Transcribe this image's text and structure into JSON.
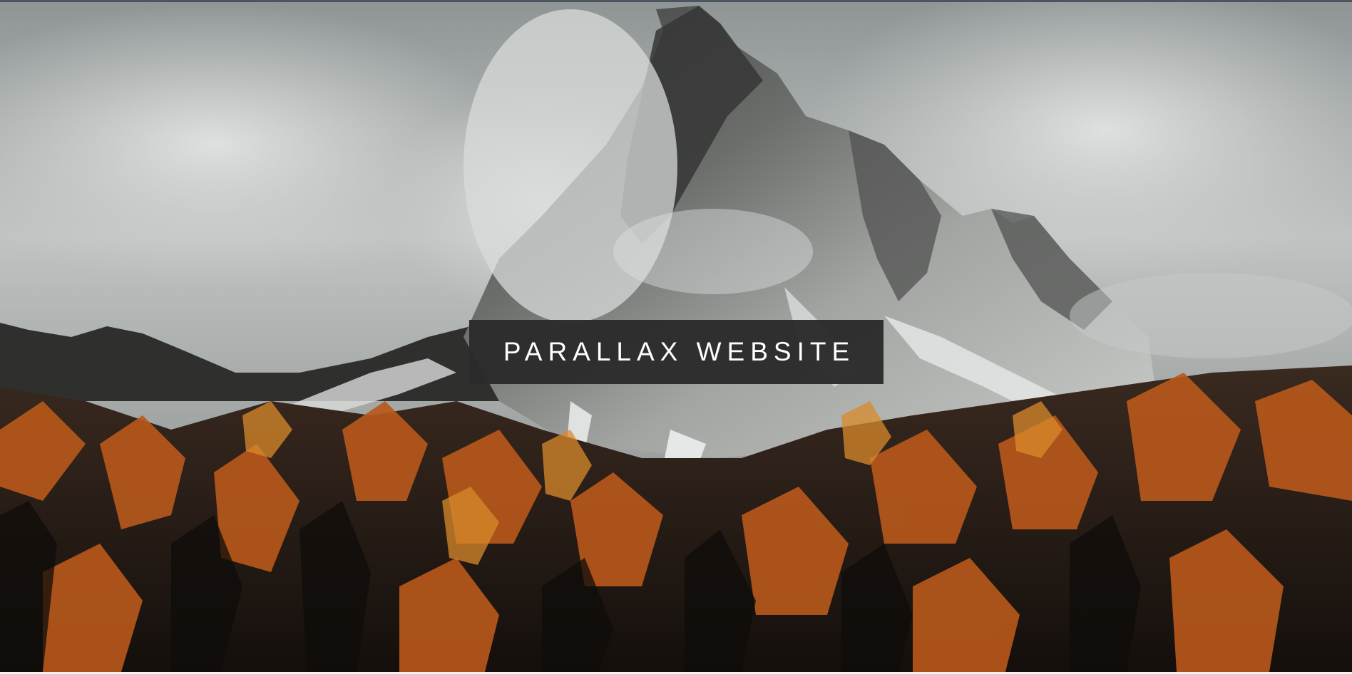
{
  "hero": {
    "title": "PARALLAX WEBSITE",
    "background_image": "misty mountain peak above autumn larch forest",
    "colors": {
      "title_box_bg": "#2b2b2b",
      "title_text": "#ffffff",
      "sky": "#b6bbbb",
      "rock": "#8a8c8a",
      "forest_orange": "#c4621c",
      "forest_dark": "#1c1613"
    }
  }
}
